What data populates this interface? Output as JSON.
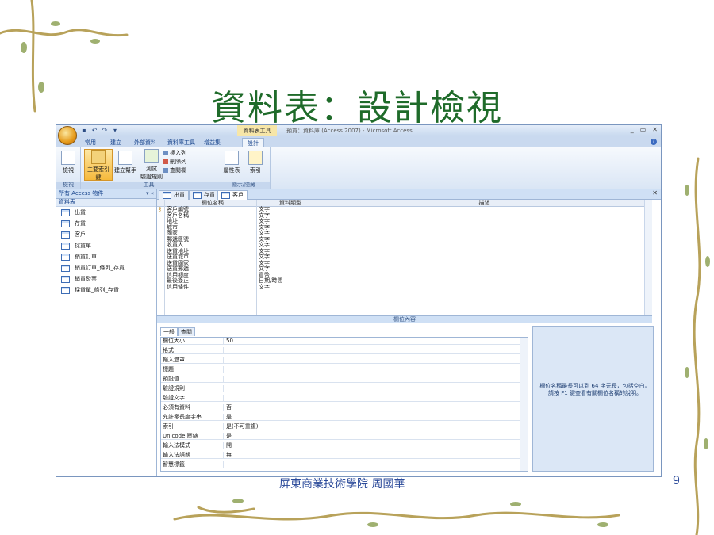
{
  "slide": {
    "title": "資料表：設計檢視",
    "footer": "屏東商業技術學院  周國華",
    "page_number": "9"
  },
  "window": {
    "contextual_tab_title": "資料表工具",
    "app_title": "預貨：資料庫 (Access 2007) - Microsoft Access",
    "controls": [
      "_",
      "▭",
      "✕"
    ],
    "help": "?"
  },
  "ribbon_tabs": [
    "常用",
    "建立",
    "外部資料",
    "資料庫工具",
    "增益集",
    "設計"
  ],
  "ribbon": {
    "view_label": "檢視",
    "view_group": "檢視",
    "primary_key": "主要索引鍵",
    "builder": "建立幫手",
    "test_rules_line1": "測試",
    "test_rules_line2": "驗證規則",
    "insert_rows": "插入列",
    "delete_rows": "刪除列",
    "lookup_column": "查閱欄",
    "tools_group": "工具",
    "property_sheet": "屬性表",
    "indexes": "索引",
    "show_hide_group": "顯示/隱藏"
  },
  "nav": {
    "header": "所有 Access 物件",
    "group": "資料表",
    "items": [
      "出貨",
      "存貨",
      "客戶",
      "採貨單",
      "銷貨訂單",
      "銷貨訂單_條列_存貨",
      "銷貨發票",
      "採貨單_條列_存貨"
    ]
  },
  "doc_tabs": [
    "出貨",
    "存貨",
    "客戶"
  ],
  "grid": {
    "headers": [
      "欄位名稱",
      "資料類型",
      "描述"
    ],
    "rows": [
      {
        "name": "客戶編號",
        "type": "文字"
      },
      {
        "name": "客戶名稱",
        "type": "文字"
      },
      {
        "name": "地址",
        "type": "文字"
      },
      {
        "name": "城市",
        "type": "文字"
      },
      {
        "name": "國家",
        "type": "文字"
      },
      {
        "name": "郵遞區號",
        "type": "文字"
      },
      {
        "name": "收貨人",
        "type": "文字"
      },
      {
        "name": "送貨地址",
        "type": "文字"
      },
      {
        "name": "送貨城市",
        "type": "文字"
      },
      {
        "name": "送貨國家",
        "type": "文字"
      },
      {
        "name": "送貨郵遞",
        "type": "文字"
      },
      {
        "name": "信用額度",
        "type": "貨幣"
      },
      {
        "name": "最後簽正",
        "type": "日期/時間"
      },
      {
        "name": "信用條件",
        "type": "文字"
      }
    ]
  },
  "field_props": {
    "section_label": "欄位內容",
    "tabs": [
      "一般",
      "查閱"
    ],
    "rows": [
      {
        "name": "欄位大小",
        "value": "50"
      },
      {
        "name": "格式",
        "value": ""
      },
      {
        "name": "輸入遮罩",
        "value": ""
      },
      {
        "name": "標題",
        "value": ""
      },
      {
        "name": "預設值",
        "value": ""
      },
      {
        "name": "驗證規則",
        "value": ""
      },
      {
        "name": "驗證文字",
        "value": ""
      },
      {
        "name": "必須有資料",
        "value": "否"
      },
      {
        "name": "允許零長度字串",
        "value": "是"
      },
      {
        "name": "索引",
        "value": "是(不可重複)"
      },
      {
        "name": "Unicode 壓縮",
        "value": "是"
      },
      {
        "name": "輸入法模式",
        "value": "開"
      },
      {
        "name": "輸入法語態",
        "value": "無"
      },
      {
        "name": "智慧標籤",
        "value": ""
      }
    ],
    "help_text": "欄位名稱最長可以到 64 字元長，包括空白。請按 F1 鍵查看有關欄位名稱的說明。"
  }
}
